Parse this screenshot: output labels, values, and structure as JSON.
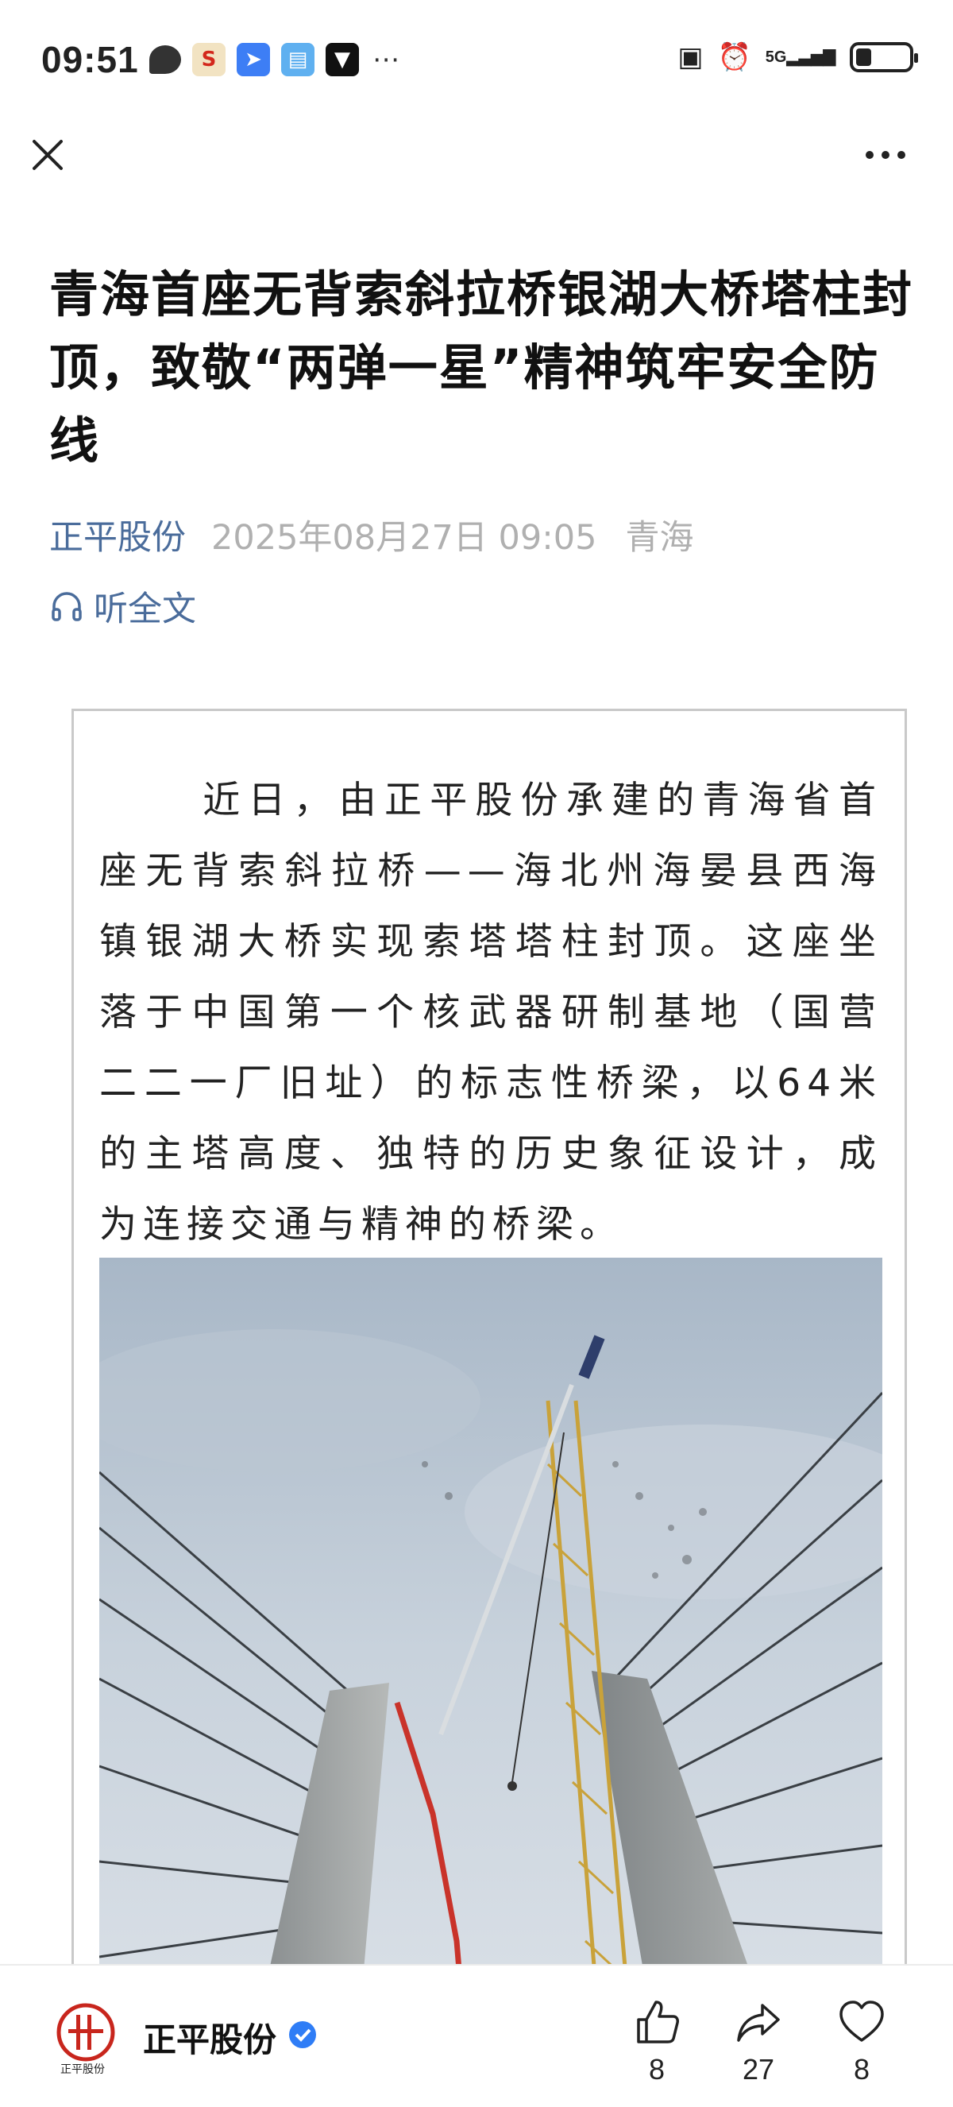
{
  "status_bar": {
    "time": "09:51",
    "signal_label": "5G",
    "battery_level": 0.3
  },
  "nav": {
    "close_icon": "close-icon",
    "more_icon": "more-icon"
  },
  "article": {
    "title": "青海首座无背索斜拉桥银湖大桥塔柱封顶，致敬“两弹一星”精神筑牢安全防线",
    "source": "正平股份",
    "date": "2025年08月27日 09:05",
    "region": "青海",
    "listen_label": "听全文",
    "body": "近日，由正平股份承建的青海省首座无背索斜拉桥——海北州海晏县西海镇银湖大桥实现索塔塔柱封顶。这座坐落于中国第一个核武器研制基地（国营二二一厂旧址）的标志性桥梁，以64米的主塔高度、独特的历史象征设计，成为连接交通与精神的桥梁。"
  },
  "bottom_bar": {
    "account_name": "正平股份",
    "logo_caption": "正平股份",
    "likes": "8",
    "shares": "27",
    "favorites": "8"
  },
  "colors": {
    "link": "#4a6c9b",
    "meta_gray": "#b0b0b0",
    "logo_red": "#c8261d",
    "verified_blue": "#2f7df6"
  }
}
